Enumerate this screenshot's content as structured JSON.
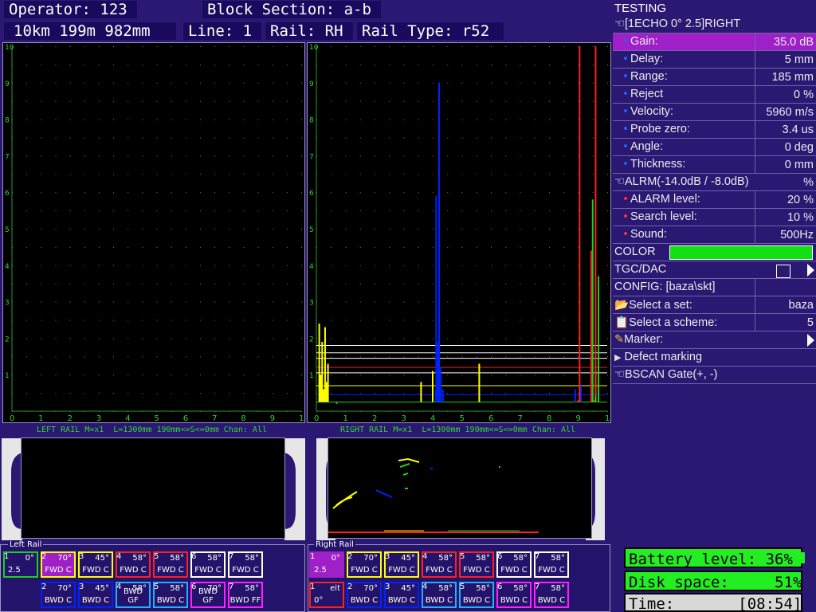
{
  "header": {
    "operator": "Operator: 123",
    "block_section": "Block Section: a-b",
    "position": "10km 199m 982mm",
    "line": "Line: 1",
    "rail": "Rail: RH",
    "rail_type": "Rail Type: r52"
  },
  "chart_data": [
    {
      "type": "line",
      "name": "left-ascan",
      "xlim": [
        0,
        10
      ],
      "ylim": [
        0,
        10
      ],
      "x_ticks": [
        "0",
        "1",
        "2",
        "3",
        "4",
        "5",
        "6",
        "7",
        "8",
        "9",
        "10"
      ],
      "y_ticks": [
        "1",
        "2",
        "3",
        "4",
        "5",
        "6",
        "7",
        "8",
        "9",
        "10"
      ],
      "series": []
    },
    {
      "type": "line",
      "name": "right-ascan",
      "xlim": [
        0,
        10
      ],
      "ylim": [
        0,
        10
      ],
      "x_ticks": [
        "0",
        "1",
        "2",
        "3",
        "4",
        "5",
        "6",
        "7",
        "8",
        "9",
        "10"
      ],
      "y_ticks": [
        "1",
        "2",
        "3",
        "4",
        "5",
        "6",
        "7",
        "8",
        "9",
        "10"
      ],
      "series": [
        {
          "color": "#ffff00",
          "points": [
            [
              0.1,
              2.4
            ],
            [
              0.15,
              1.0
            ],
            [
              0.2,
              1.9
            ],
            [
              0.25,
              0.6
            ],
            [
              0.3,
              2.3
            ],
            [
              0.35,
              0.8
            ],
            [
              0.4,
              1.3
            ],
            [
              3.6,
              0.8
            ],
            [
              4.0,
              1.1
            ],
            [
              5.6,
              1.3
            ],
            [
              9.6,
              1.1
            ]
          ]
        },
        {
          "color": "#0022ff",
          "points": [
            [
              4.1,
              0.6
            ],
            [
              4.12,
              5.9
            ],
            [
              4.18,
              1.9
            ],
            [
              4.22,
              9.0
            ],
            [
              4.28,
              1.2
            ],
            [
              4.35,
              0.6
            ],
            [
              8.9,
              0.6
            ],
            [
              9.1,
              0.7
            ]
          ]
        },
        {
          "color": "#ff2020",
          "points": [
            [
              9.0,
              0.3
            ],
            [
              9.05,
              10.0
            ],
            [
              9.45,
              4.4
            ],
            [
              9.55,
              0.3
            ],
            [
              9.6,
              10.0
            ]
          ]
        },
        {
          "color": "#20d020",
          "points": [
            [
              0.7,
              0.2
            ],
            [
              9.5,
              5.8
            ],
            [
              9.6,
              0.4
            ],
            [
              9.7,
              3.7
            ]
          ]
        }
      ],
      "gates": [
        {
          "y": 1.8,
          "color": "#ffffff"
        },
        {
          "y": 1.6,
          "color": "#ffffff"
        },
        {
          "y": 1.45,
          "color": "#ffffff"
        },
        {
          "y": 1.2,
          "color": "#ff2020"
        },
        {
          "y": 1.05,
          "color": "#ffffff"
        },
        {
          "y": 0.7,
          "color": "#ffff00"
        },
        {
          "y": 0.45,
          "color": "#0022ff"
        },
        {
          "y": 0.25,
          "color": "#20d020"
        }
      ]
    }
  ],
  "bscan": {
    "left_title": "LEFT RAIL M=x1  L=1300mm 190mm<=S<=0mm Chan: All",
    "right_title": "RIGHT RAIL M=x1  L=1300mm 190mm<=S<=0mm Chan: All"
  },
  "sidebar": {
    "title": "TESTING",
    "echo_header": "[1ECHO 0° 2.5]RIGHT",
    "params": [
      {
        "label": "Gain:",
        "value": "35.0 dB",
        "selected": true
      },
      {
        "label": "Delay:",
        "value": "5 mm"
      },
      {
        "label": "Range:",
        "value": "185 mm"
      },
      {
        "label": "Reject",
        "value": "0 %"
      },
      {
        "label": "Velocity:",
        "value": "5960 m/s"
      },
      {
        "label": "Probe zero:",
        "value": "3.4 us"
      },
      {
        "label": "Angle:",
        "value": "0 deg"
      },
      {
        "label": "Thickness:",
        "value": "0 mm"
      }
    ],
    "alarm_header": "ALRM(-14.0dB / -8.0dB)",
    "alarm_unit": "%",
    "alarms": [
      {
        "label": "ALARM level:",
        "value": "20 %"
      },
      {
        "label": "Search level:",
        "value": "10 %"
      },
      {
        "label": "Sound:",
        "value": "500Hz"
      }
    ],
    "color_label": "COLOR",
    "color_value": "#12e012",
    "tgc_label": "TGC/DAC",
    "config_label": "CONFIG: [baza\\skt]",
    "select_set_label": "Select a set:",
    "select_set_value": "baza",
    "select_scheme_label": "Select a scheme:",
    "select_scheme_value": "5",
    "marker_label": "Marker:",
    "defect_marking_label": "Defect marking",
    "bscan_gate_label": "BSCAN Gate(+, -)"
  },
  "left_rail": {
    "title": "Left Rail",
    "top": [
      {
        "n": "1",
        "a": "0°",
        "mode": "2.5",
        "color": "#20d020",
        "bg": "#24136a"
      },
      {
        "n": "2",
        "a": "70°",
        "mode": "FWD C",
        "color": "#ffff00",
        "bg": "#a020c8"
      },
      {
        "n": "3",
        "a": "45°",
        "mode": "FWD C",
        "color": "#ffff00",
        "bg": "#24136a"
      },
      {
        "n": "4",
        "a": "58°",
        "mode": "FWD C",
        "color": "#ff2020",
        "bg": "#24136a"
      },
      {
        "n": "5",
        "a": "58°",
        "mode": "FWD C",
        "color": "#ff2020",
        "bg": "#24136a"
      },
      {
        "n": "6",
        "a": "58°",
        "mode": "FWD C",
        "color": "#ffffff",
        "bg": "#24136a"
      },
      {
        "n": "7",
        "a": "58°",
        "mode": "FWD C",
        "color": "#ffffff",
        "bg": "#24136a"
      }
    ],
    "bottom": [
      {
        "n": "2",
        "a": "70°",
        "mode": "BWD C",
        "color": "#0022ff"
      },
      {
        "n": "3",
        "a": "45°",
        "mode": "BWD C",
        "color": "#0022ff"
      },
      {
        "n": "4",
        "a": "58°",
        "mode": "BWD GF",
        "color": "#20b0ff"
      },
      {
        "n": "5",
        "a": "58°",
        "mode": "BWD C",
        "color": "#20b0ff"
      },
      {
        "n": "6",
        "a": "70°",
        "mode": "BWD GF",
        "color": "#ff20ff"
      },
      {
        "n": "7",
        "a": "58°",
        "mode": "BWD FF",
        "color": "#ff20ff"
      }
    ]
  },
  "right_rail": {
    "title": "Right Rail",
    "top": [
      {
        "n": "1",
        "a": "0°",
        "mode": "2.5",
        "color": "#a020c8",
        "bg": "#a020c8"
      },
      {
        "n": "2",
        "a": "70°",
        "mode": "FWD C",
        "color": "#ffff00",
        "bg": "#24136a"
      },
      {
        "n": "3",
        "a": "45°",
        "mode": "FWD C",
        "color": "#ffff00",
        "bg": "#24136a"
      },
      {
        "n": "4",
        "a": "58°",
        "mode": "FWD C",
        "color": "#ff2020",
        "bg": "#24136a"
      },
      {
        "n": "5",
        "a": "58°",
        "mode": "FWD C",
        "color": "#ff2020",
        "bg": "#24136a"
      },
      {
        "n": "6",
        "a": "58°",
        "mode": "FWD C",
        "color": "#ffffff",
        "bg": "#24136a"
      },
      {
        "n": "7",
        "a": "58°",
        "mode": "FWD C",
        "color": "#ffffff",
        "bg": "#24136a"
      }
    ],
    "bottom": [
      {
        "n": "1",
        "a": "eit",
        "mode": "0°",
        "color": "#ff2020"
      },
      {
        "n": "2",
        "a": "70°",
        "mode": "BWD C",
        "color": "#0022ff"
      },
      {
        "n": "3",
        "a": "45°",
        "mode": "BWD C",
        "color": "#0022ff"
      },
      {
        "n": "4",
        "a": "58°",
        "mode": "BWD C",
        "color": "#20b0ff"
      },
      {
        "n": "5",
        "a": "58°",
        "mode": "BWD C",
        "color": "#20b0ff"
      },
      {
        "n": "6",
        "a": "58°",
        "mode": "BWD C",
        "color": "#ff20ff"
      },
      {
        "n": "7",
        "a": "58°",
        "mode": "BWD C",
        "color": "#ff20ff"
      }
    ]
  },
  "status": {
    "battery": "Battery level: 36%",
    "disk": "Disk space:     51%",
    "time": "Time:       [08:54]"
  }
}
